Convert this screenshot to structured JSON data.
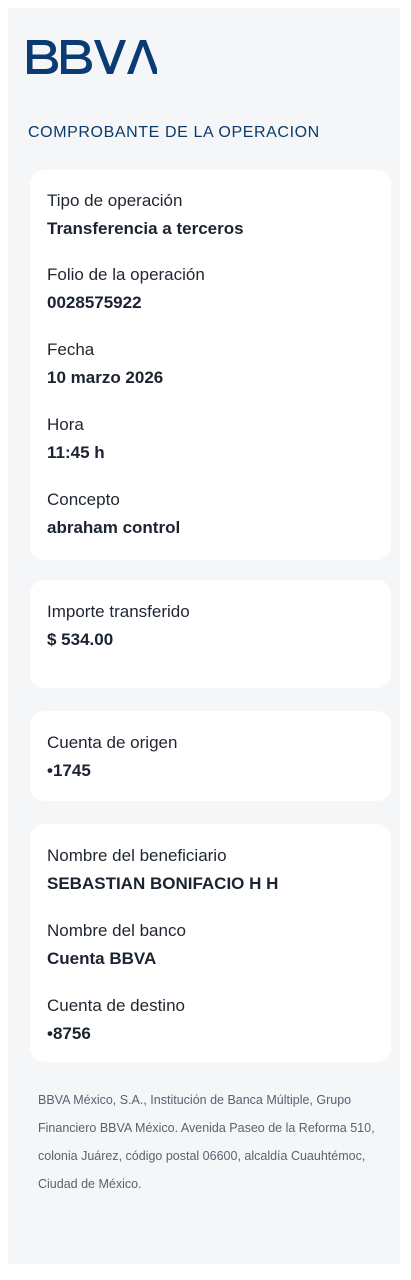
{
  "brand": {
    "logo_text": "BBVA",
    "colors": {
      "brand_blue": "#0b3b75",
      "section_title": "#0c3a6b",
      "background_panel": "#f4f6f8",
      "card_bg": "#ffffff"
    }
  },
  "header": {
    "title": "COMPROBANTE DE LA OPERACION"
  },
  "cards": {
    "operation": {
      "fields": [
        {
          "label": "Tipo de operación",
          "value": "Transferencia a terceros"
        },
        {
          "label": "Folio de la operación",
          "value": "0028575922"
        },
        {
          "label": "Fecha",
          "value": "10 marzo 2026"
        },
        {
          "label": "Hora",
          "value": "11:45 h"
        },
        {
          "label": "Concepto",
          "value": "abraham control"
        }
      ]
    },
    "amount": {
      "fields": [
        {
          "label": "Importe transferido",
          "value": "$ 534.00"
        }
      ]
    },
    "origin": {
      "fields": [
        {
          "label": "Cuenta de origen",
          "value": "•1745"
        }
      ]
    },
    "beneficiary": {
      "fields": [
        {
          "label": "Nombre del beneficiario",
          "value": "SEBASTIAN BONIFACIO H H"
        },
        {
          "label": "Nombre del banco",
          "value": "Cuenta BBVA"
        },
        {
          "label": "Cuenta de destino",
          "value": "•8756"
        }
      ]
    }
  },
  "footer": {
    "legal_text": "BBVA México, S.A., Institución de Banca Múltiple, Grupo Financiero BBVA México. Avenida Paseo de la Reforma 510, colonia Juárez, código postal 06600, alcaldía Cuauhtémoc, Ciudad de México."
  }
}
